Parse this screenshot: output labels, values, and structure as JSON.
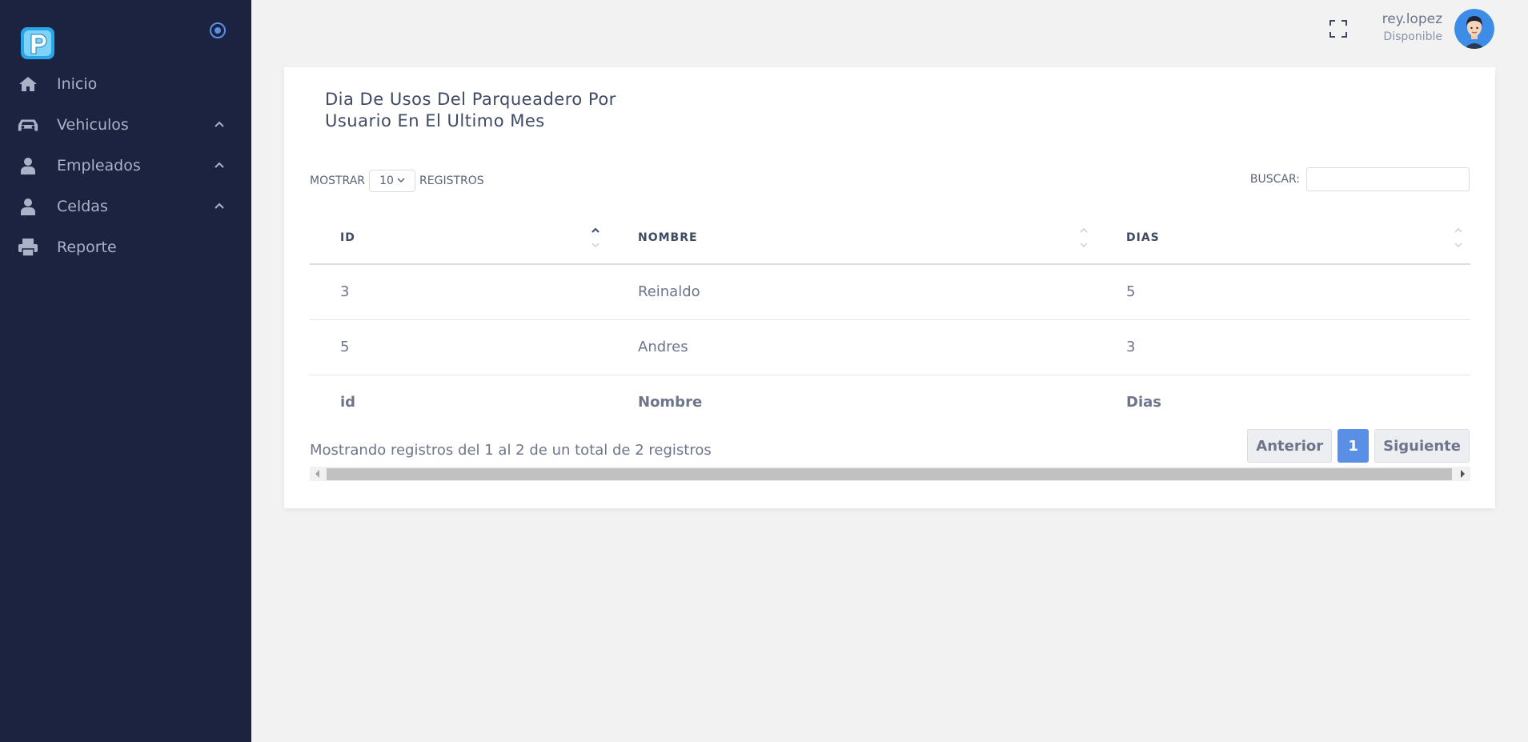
{
  "sidebar": {
    "items": [
      {
        "label": "Inicio",
        "icon": "home-icon"
      },
      {
        "label": "Vehiculos",
        "icon": "car-icon",
        "expandable": true
      },
      {
        "label": "Empleados",
        "icon": "user-icon",
        "expandable": true
      },
      {
        "label": "Celdas",
        "icon": "user-icon",
        "expandable": true
      },
      {
        "label": "Reporte",
        "icon": "printer-icon"
      }
    ]
  },
  "topbar": {
    "user_name": "rey.lopez",
    "user_status": "Disponible"
  },
  "card": {
    "title": "Dia De Usos Del Parqueadero Por Usuario En El Ultimo Mes",
    "length_prefix": "MOSTRAR",
    "length_value": "10",
    "length_suffix": "REGISTROS",
    "search_label": "BUSCAR:",
    "search_value": "",
    "columns": [
      "ID",
      "NOMBRE",
      "DIAS"
    ],
    "rows": [
      [
        "3",
        "Reinaldo",
        "5"
      ],
      [
        "5",
        "Andres",
        "3"
      ]
    ],
    "footer": [
      "id",
      "Nombre",
      "Dias"
    ],
    "info": "Mostrando registros del 1 al 2 de un total de 2 registros",
    "pager": {
      "prev": "Anterior",
      "current": "1",
      "next": "Siguiente"
    }
  },
  "colors": {
    "sidebar_bg": "#1b2341",
    "page_bg": "#f1f2f1",
    "accent": "#5a8fe6"
  }
}
